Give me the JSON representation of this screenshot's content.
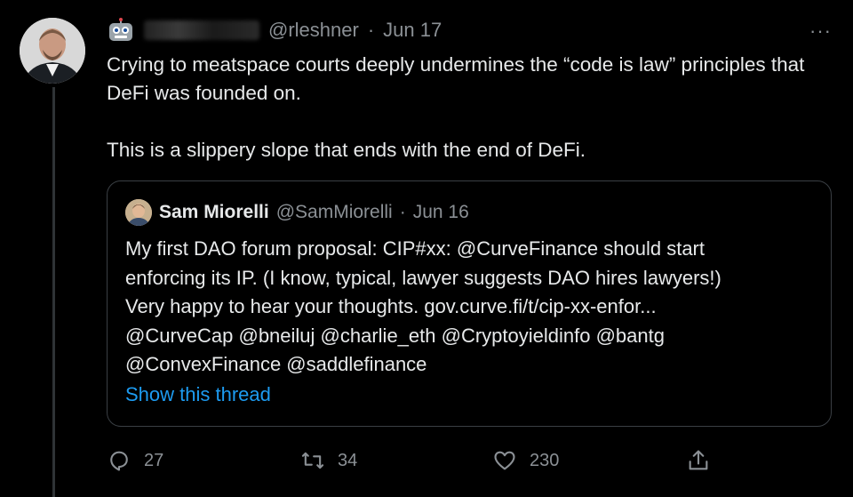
{
  "tweet": {
    "handle": "@rleshner",
    "separator": "·",
    "date": "Jun 17",
    "paragraphs": [
      "Crying to meatspace courts deeply undermines the “code is law” principles that DeFi was founded on.",
      "This is a slippery slope that ends with the end of DeFi."
    ],
    "more": "···"
  },
  "quote": {
    "name": "Sam Miorelli",
    "handle": "@SamMiorelli",
    "separator": "·",
    "date": "Jun 16",
    "lines": [
      "My first DAO forum proposal: CIP#xx: @CurveFinance should start",
      "enforcing its IP. (I know, typical, lawyer suggests DAO hires lawyers!)",
      "Very happy to hear your thoughts. gov.curve.fi/t/cip-xx-enfor...",
      "@CurveCap @bneiluj @charlie_eth @Cryptoyieldinfo @bantg",
      "@ConvexFinance @saddlefinance"
    ],
    "show_thread": "Show this thread"
  },
  "actions": {
    "replies": "27",
    "retweets": "34",
    "likes": "230",
    "icons": [
      "reply-icon",
      "retweet-icon",
      "like-icon",
      "share-icon"
    ]
  },
  "colors": {
    "background": "#000000",
    "text": "#e7e9ea",
    "muted": "#8b9095",
    "link": "#1d9bf0",
    "border": "#3a3f44"
  }
}
